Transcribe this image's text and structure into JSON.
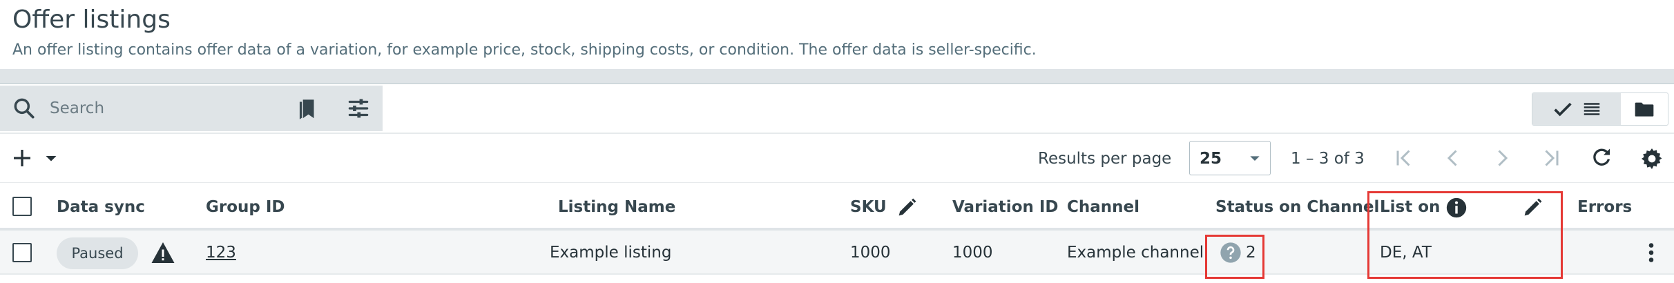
{
  "header": {
    "title": "Offer listings",
    "description": "An offer listing contains offer data of a variation, for example price, stock, shipping costs, or condition. The offer data is seller-specific."
  },
  "search": {
    "placeholder": "Search",
    "icons": [
      "search-icon",
      "bookmark-icon",
      "filter-sliders-icon"
    ]
  },
  "view_switcher": {
    "icons": [
      "checkmark-icon",
      "list-view-icon",
      "folder-icon"
    ],
    "active": "checkmark-icon"
  },
  "toolbar": {
    "icons": [
      "plus-icon",
      "chevron-down-icon"
    ],
    "results_per_page_label": "Results per page",
    "results_per_page_value": "25",
    "range": "1 – 3 of 3",
    "pagination_icons": [
      "first-page-icon",
      "previous-page-icon",
      "next-page-icon",
      "last-page-icon",
      "refresh-icon",
      "gear-icon"
    ]
  },
  "table": {
    "columns": {
      "data_sync": "Data sync",
      "group_id": "Group ID",
      "listing_name": "Listing Name",
      "sku": "SKU",
      "variation_id": "Variation ID",
      "channel": "Channel",
      "status_on_channel": "Status on Channel",
      "list_on": "List on",
      "errors": "Errors"
    },
    "rows": [
      {
        "data_sync": "Paused",
        "group_id": "123",
        "listing_name": "Example listing",
        "sku": "1000",
        "variation_id": "1000",
        "channel": "Example channel",
        "status_on_channel": "2",
        "list_on": "DE, AT",
        "errors": ""
      }
    ]
  },
  "colors": {
    "highlight": "#e53935",
    "toolbar_grey": "#dfe4e7",
    "text": "#37474f"
  }
}
